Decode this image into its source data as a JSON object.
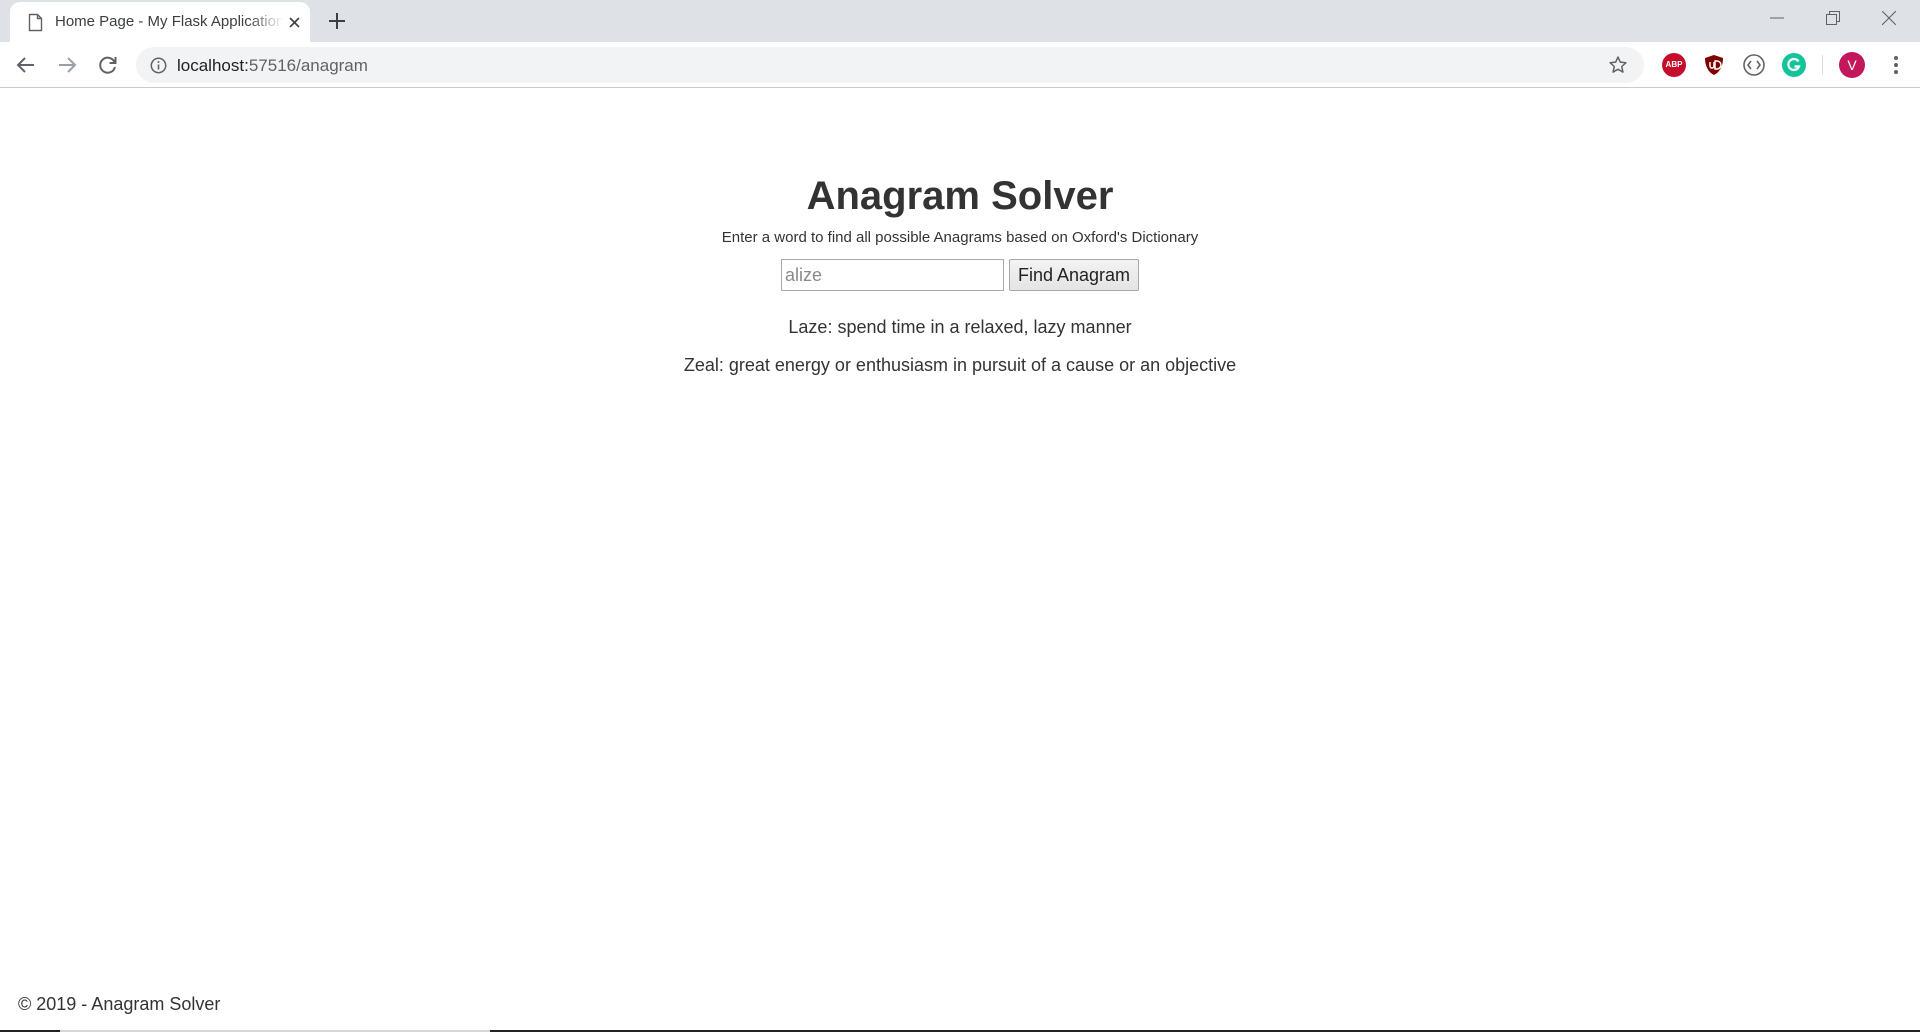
{
  "browser": {
    "tab_title": "Home Page - My Flask Application",
    "url_host": "localhost:",
    "url_path": "57516/anagram",
    "avatar_letter": "V",
    "abp_label": "ABP"
  },
  "page": {
    "title": "Anagram Solver",
    "subtitle": "Enter a word to find all possible Anagrams based on Oxford's Dictionary",
    "input_placeholder": "alize",
    "button_label": "Find Anagram",
    "results": [
      "Laze: spend time in a relaxed, lazy manner",
      "Zeal: great energy or enthusiasm in pursuit of a cause or an objective"
    ],
    "footer": "© 2019 - Anagram Solver"
  }
}
